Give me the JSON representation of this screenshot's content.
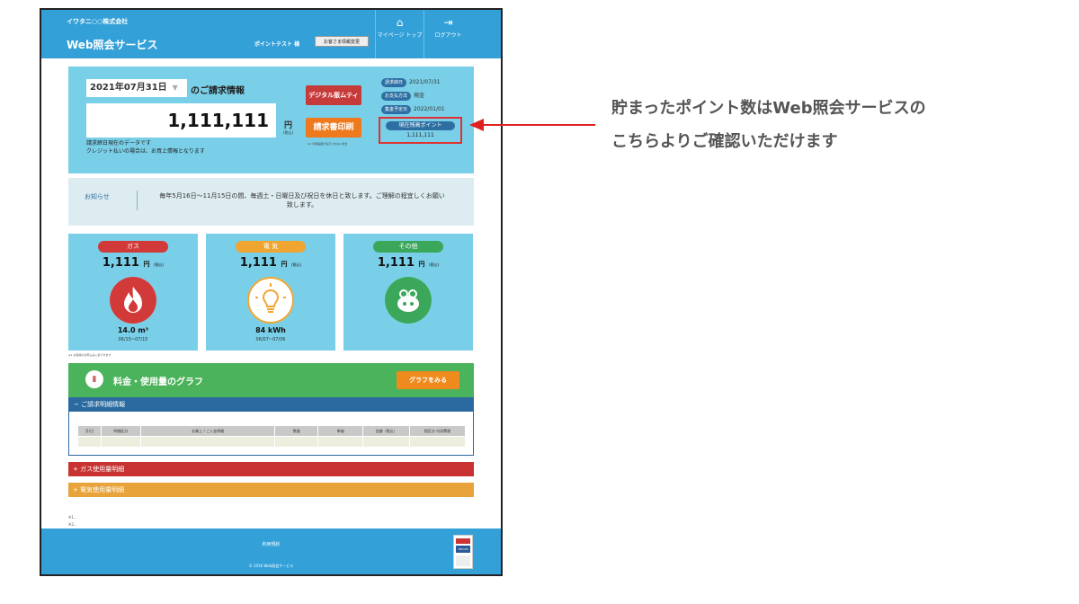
{
  "header": {
    "company": "イワタニ○○株式会社",
    "service_name": "Web照会サービス",
    "user_name": "ポイントテスト 様",
    "customer_info_button": "お客さま情報変更",
    "nav": [
      {
        "label": "マイページ トップ",
        "icon": "home-icon"
      },
      {
        "label": "ログアウト",
        "icon": "logout-icon"
      }
    ]
  },
  "billing": {
    "date_selected": "2021年07月31日",
    "title": "のご請求情報",
    "amount": "1,111,111",
    "yen": "円",
    "tax": "(税込)",
    "note_line1": "請求締日現在のデータです",
    "note_line2": "クレジット払いの場合は、お買上情報となります",
    "digital_button": "デジタル版ムティ",
    "print_button": "請求書印刷",
    "print_note": "※1 印刷画面が表示されない場合",
    "info": [
      {
        "label": "請求締日",
        "value": "2021/07/31"
      },
      {
        "label": "お支払方法",
        "value": "現金"
      },
      {
        "label": "集金予定日",
        "value": "2022/01/01"
      }
    ],
    "points_label": "現在残高ポイント",
    "points_value": "1,111,111"
  },
  "notice": {
    "label": "お知らせ",
    "text": "毎年5月16日～11月15日の間、毎週土・日曜日及び祝日を休日と致します。ご理解の程宜しくお願い致します。"
  },
  "utilities": [
    {
      "name": "ガス",
      "amount": "1,111",
      "unit": "円",
      "tax": "(税込)",
      "usage": "14.0 m³",
      "period": "06/15~07/15",
      "color": "#d23a3a",
      "icon": "flame-icon"
    },
    {
      "name": "電 気",
      "amount": "1,111",
      "unit": "円",
      "tax": "(税込)",
      "usage": "84 kWh",
      "period": "06/07~07/06",
      "color": "#f0a530",
      "icon": "lightbulb-icon"
    },
    {
      "name": "その他",
      "amount": "1,111",
      "unit": "円",
      "tax": "(税込)",
      "usage": "",
      "period": "",
      "color": "#3aa75a",
      "icon": "bag-icon"
    }
  ],
  "tiny_note": "※1 お客様のお申込みに基づきます",
  "graph": {
    "title": "料金・使用量のグラフ",
    "button": "グラフをみる"
  },
  "detail": {
    "header": "− ご請求明細情報",
    "columns": [
      "月/日",
      "明細区分",
      "お買上 / ご入金明細",
      "数量",
      "単価",
      "金額（税込）",
      "税区分 内消費税"
    ]
  },
  "accordions": [
    {
      "label": "+ ガス使用量明細",
      "color": "#c83232"
    },
    {
      "label": "+ 電気使用量明細",
      "color": "#e8a33a"
    }
  ],
  "footer_links": [
    "※1…",
    "※2…"
  ],
  "footer": {
    "terms": "利用規約",
    "copyright": "© 2016 Web照会サービス"
  },
  "secom_badge": "SECOM",
  "annotation": {
    "line1": "貯まったポイント数はWeb照会サービスの",
    "line2": "こちらよりご確認いただけます"
  }
}
